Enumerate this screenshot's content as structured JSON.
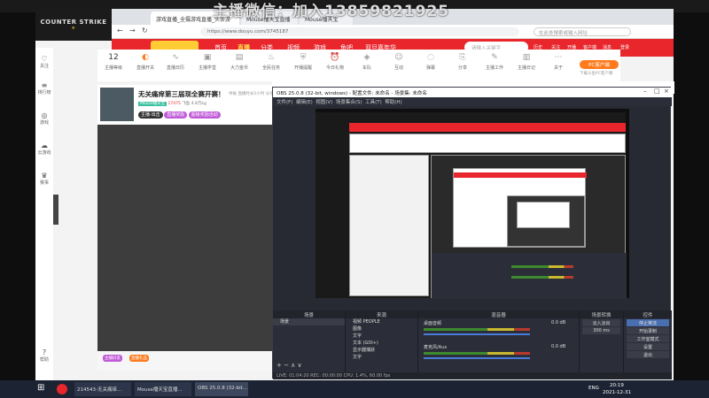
{
  "logo": {
    "name": "COUNTER STRIKE"
  },
  "browser": {
    "tabs": [
      "游戏直播_全摄游戏直播_头条游",
      "Mouse播天宝直播",
      "Mouse播天宝"
    ],
    "url": "https://www.douyu.com/3745187",
    "search_placeholder": "在此处搜索或输入网址",
    "watermark": "主播微信：加入13859821925"
  },
  "douyu": {
    "nav": [
      "首页",
      "直播",
      "分类",
      "视频",
      "游戏",
      "鱼吧",
      "双旦嘉年华"
    ],
    "search_placeholder": "请输入关键字",
    "header_icons": [
      "历史",
      "关注",
      "开播",
      "客户端",
      "消息",
      "登录"
    ],
    "categories": [
      "主播等级",
      "直播开关",
      "直播日历",
      "主播学堂",
      "大力金币",
      "全民任务",
      "开播提醒",
      "今日礼物",
      "车队",
      "互动",
      "弹幕",
      "分享",
      "主播工作",
      "主播日记",
      "关于"
    ],
    "level": "12",
    "pc_button": "PC客户端",
    "pc_sub": "下载斗鱼PC客户端",
    "room_title": "无关痛痒第三届现全赛开赛！",
    "room_meta": [
      "举报",
      "直播时长5小时",
      "分享"
    ],
    "room_tags": [
      "Mouse播天宝",
      "17475",
      "飞鱼",
      "4.8万kg"
    ],
    "room_buttons": [
      "主播·出击",
      "直播奖励",
      "超级奖励活动"
    ],
    "left_rail": [
      "关注",
      "排行榜",
      "游戏",
      "云游戏",
      "赛事",
      "帮助"
    ],
    "bottom_badges": [
      "主播好友",
      "直播礼品"
    ]
  },
  "obs": {
    "title": "OBS 25.0.8 (32-bit, windows) - 配置文件: 未命名 - 场景集: 未命名",
    "menu": [
      "文件(F)",
      "编辑(E)",
      "视图(V)",
      "场景集合(S)",
      "工具(T)",
      "帮助(H)"
    ],
    "docks": [
      "场景",
      "来源",
      "混音器",
      "场景转换",
      "控件"
    ],
    "scene": "场景",
    "sources": [
      "视频 PEOPLE",
      "图像",
      "文字",
      "文本 (GDI+)",
      "显示器捕获",
      "文字"
    ],
    "mixer": [
      {
        "name": "桌面音频",
        "db": "0.0 dB"
      },
      {
        "name": "麦克风/Aux",
        "db": "0.0 dB"
      }
    ],
    "transition": "淡入淡出",
    "duration": "300 ms",
    "controls": [
      "停止推流",
      "开始录制",
      "工作室模式",
      "设置",
      "退出"
    ],
    "status": "LIVE: 01:04:20   REC: 00:00:00   CPU: 1.4%, 60.00 fps"
  },
  "taskbar": {
    "apps": [
      "214543-无关痛痒...",
      "Mouse播天宝直播...",
      "OBS 25.0.8 (32-bit..."
    ],
    "time": "20:19",
    "date": "2021-12-31",
    "lang": "ENG"
  }
}
